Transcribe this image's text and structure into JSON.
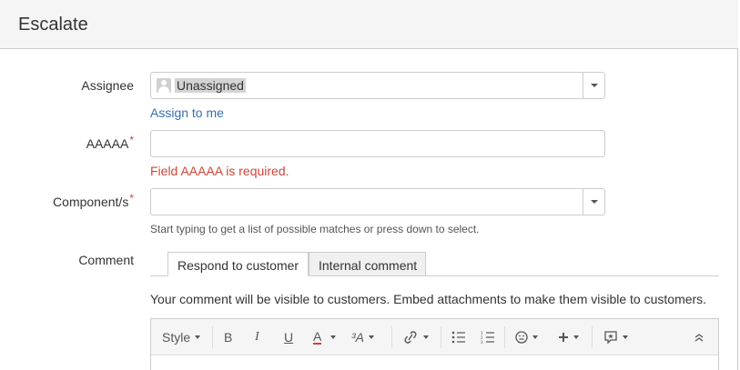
{
  "dialog": {
    "title": "Escalate"
  },
  "assignee": {
    "label": "Assignee",
    "value": "Unassigned",
    "assign_link": "Assign to me"
  },
  "aaaaa": {
    "label": "AAAAA",
    "required_mark": "*",
    "value": "",
    "error": "Field AAAAA is required."
  },
  "components": {
    "label": "Component/s",
    "required_mark": "*",
    "value": "",
    "hint": "Start typing to get a list of possible matches or press down to select."
  },
  "comment": {
    "label": "Comment",
    "tabs": [
      {
        "label": "Respond to customer",
        "active": true
      },
      {
        "label": "Internal comment",
        "active": false
      }
    ],
    "note": "Your comment will be visible to customers. Embed attachments to make them visible to customers."
  },
  "toolbar": {
    "style_label": "Style",
    "bold": "B",
    "italic": "I",
    "underline": "U",
    "text_color": "A",
    "text_size": "³A",
    "icons": [
      "link-icon",
      "bullet-list-icon",
      "numbered-list-icon",
      "emoticon-icon",
      "insert-more-icon",
      "feedback-macro-icon",
      "collapse-toolbar-icon"
    ],
    "colors": {
      "text_color_underline": "#d04437",
      "link": "#3572b0",
      "error": "#d04437"
    }
  }
}
